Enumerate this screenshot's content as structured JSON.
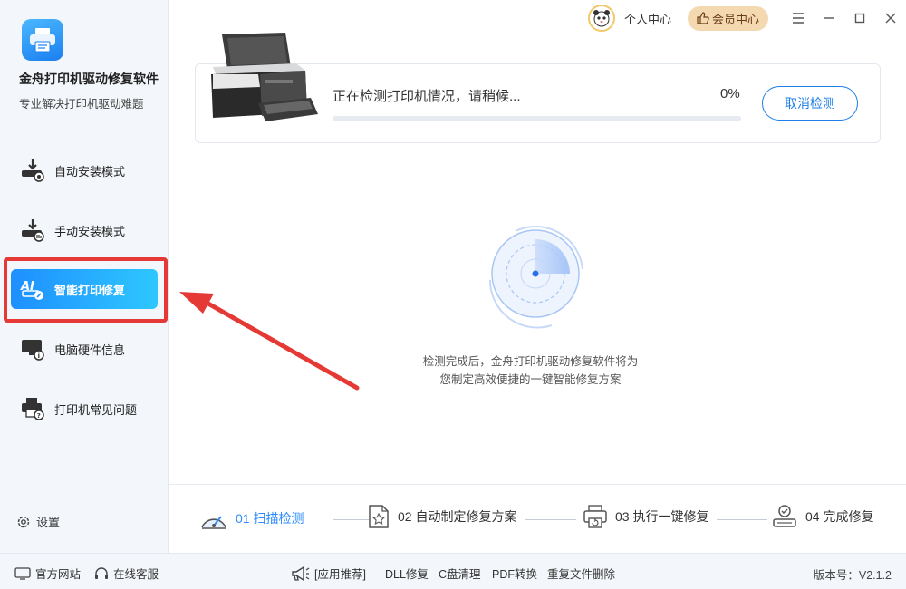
{
  "app": {
    "name": "金舟打印机驱动修复软件",
    "subtitle": "专业解决打印机驱动难题"
  },
  "sidebar": {
    "items": [
      {
        "label": "自动安装模式",
        "icon": "auto-install-icon",
        "active": false
      },
      {
        "label": "手动安装模式",
        "icon": "manual-install-icon",
        "active": false
      },
      {
        "label": "智能打印修复",
        "icon": "ai-repair-icon",
        "active": true
      },
      {
        "label": "电脑硬件信息",
        "icon": "hardware-info-icon",
        "active": false
      },
      {
        "label": "打印机常见问题",
        "icon": "printer-faq-icon",
        "active": false
      }
    ],
    "settings_label": "设置"
  },
  "topbar": {
    "user_center": "个人中心",
    "vip_center": "会员中心"
  },
  "status": {
    "text": "正在检测打印机情况，请稍候...",
    "percent_label": "0%",
    "progress": 0,
    "cancel_label": "取消检测"
  },
  "description": {
    "line1": "检测完成后，金舟打印机驱动修复软件将为",
    "line2": "您制定高效便捷的一键智能修复方案"
  },
  "steps": [
    {
      "label": "01 扫描检测",
      "icon": "scan-gauge-icon",
      "active": true
    },
    {
      "label": "02 自动制定修复方案",
      "icon": "plan-document-icon",
      "active": false
    },
    {
      "label": "03 执行一键修复",
      "icon": "repair-printer-icon",
      "active": false
    },
    {
      "label": "04 完成修复",
      "icon": "complete-check-icon",
      "active": false
    }
  ],
  "footer": {
    "official_site": "官方网站",
    "online_service": "在线客服",
    "app_recommend": "[应用推荐]",
    "links": [
      "DLL修复",
      "C盘清理",
      "PDF转换",
      "重复文件删除"
    ],
    "version": "版本号：V2.1.2"
  },
  "colors": {
    "accent": "#2b8cff",
    "highlight": "#e53935",
    "vip_bg": "#f4d9b0"
  }
}
